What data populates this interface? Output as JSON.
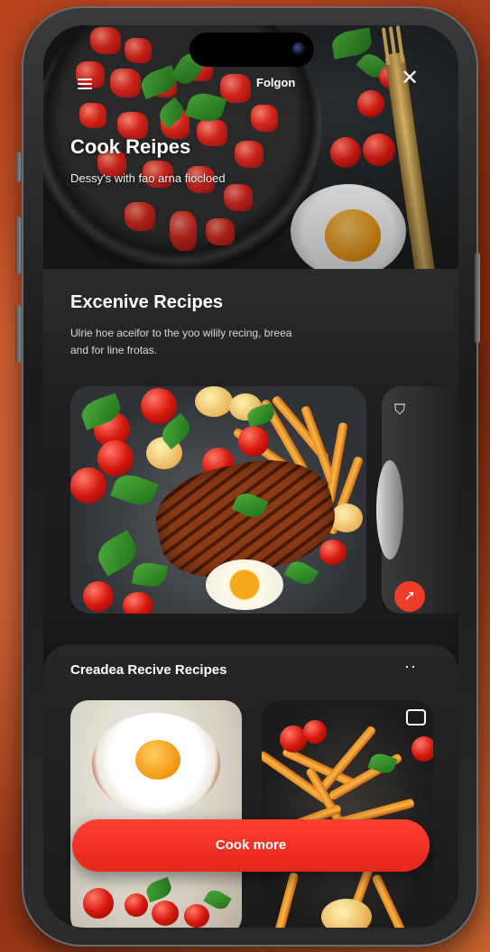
{
  "status_bar": {
    "label": "Folgon"
  },
  "hero": {
    "title": "Cook Reipes",
    "subtitle": "Dessy's with fao arna fiocloed"
  },
  "featured_section": {
    "title": "Excenive Recipes",
    "description": "Ulrie hoe aceifor to the yoo wilily recing, breea and for line frotas."
  },
  "created_section": {
    "title": "Creadea Recive Recipes",
    "more_label": "··"
  },
  "cta": {
    "label": "Cook more"
  },
  "icons": {
    "menu": "menu-icon",
    "close": "close-icon",
    "bookmark": "bookmark-icon",
    "share": "share-icon",
    "camera": "camera-icon"
  },
  "colors": {
    "accent": "#E4271B",
    "background": "#141414",
    "card": "#1E1E1E"
  }
}
